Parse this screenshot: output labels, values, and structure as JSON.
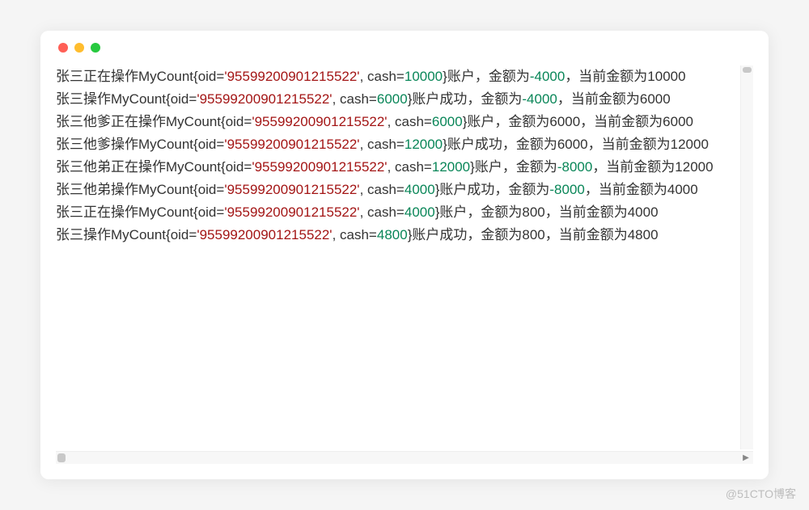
{
  "oid": "'95599200901215522'",
  "lines": [
    {
      "p1": "张三正在操作MyCount{oid=",
      "cash": "10000",
      "p2": "}账户，金额为",
      "amt": "-4000",
      "p3": "，当前金额为10000"
    },
    {
      "p1": "张三操作MyCount{oid=",
      "cash": "6000",
      "p2": "}账户成功，金额为",
      "amt": "-4000",
      "p3": "，当前金额为6000"
    },
    {
      "p1": "张三他爹正在操作MyCount{oid=",
      "cash": "6000",
      "p2": "}账户，金额为6000，当前金额为6000",
      "amt": null,
      "p3": ""
    },
    {
      "p1": "张三他爹操作MyCount{oid=",
      "cash": "12000",
      "p2": "}账户成功，金额为6000，当前金额为12000",
      "amt": null,
      "p3": ""
    },
    {
      "p1": "张三他弟正在操作MyCount{oid=",
      "cash": "12000",
      "p2": "}账户，金额为",
      "amt": "-8000",
      "p3": "，当前金额为12000"
    },
    {
      "p1": "张三他弟操作MyCount{oid=",
      "cash": "4000",
      "p2": "}账户成功，金额为",
      "amt": "-8000",
      "p3": "，当前金额为4000"
    },
    {
      "p1": "张三正在操作MyCount{oid=",
      "cash": "4000",
      "p2": "}账户，金额为800，当前金额为4000",
      "amt": null,
      "p3": ""
    },
    {
      "p1": "张三操作MyCount{oid=",
      "cash": "4800",
      "p2": "}账户成功，金额为800，当前金额为4800",
      "amt": null,
      "p3": ""
    }
  ],
  "watermark": "@51CTO博客",
  "labels": {
    "cash_prefix": ", cash="
  }
}
